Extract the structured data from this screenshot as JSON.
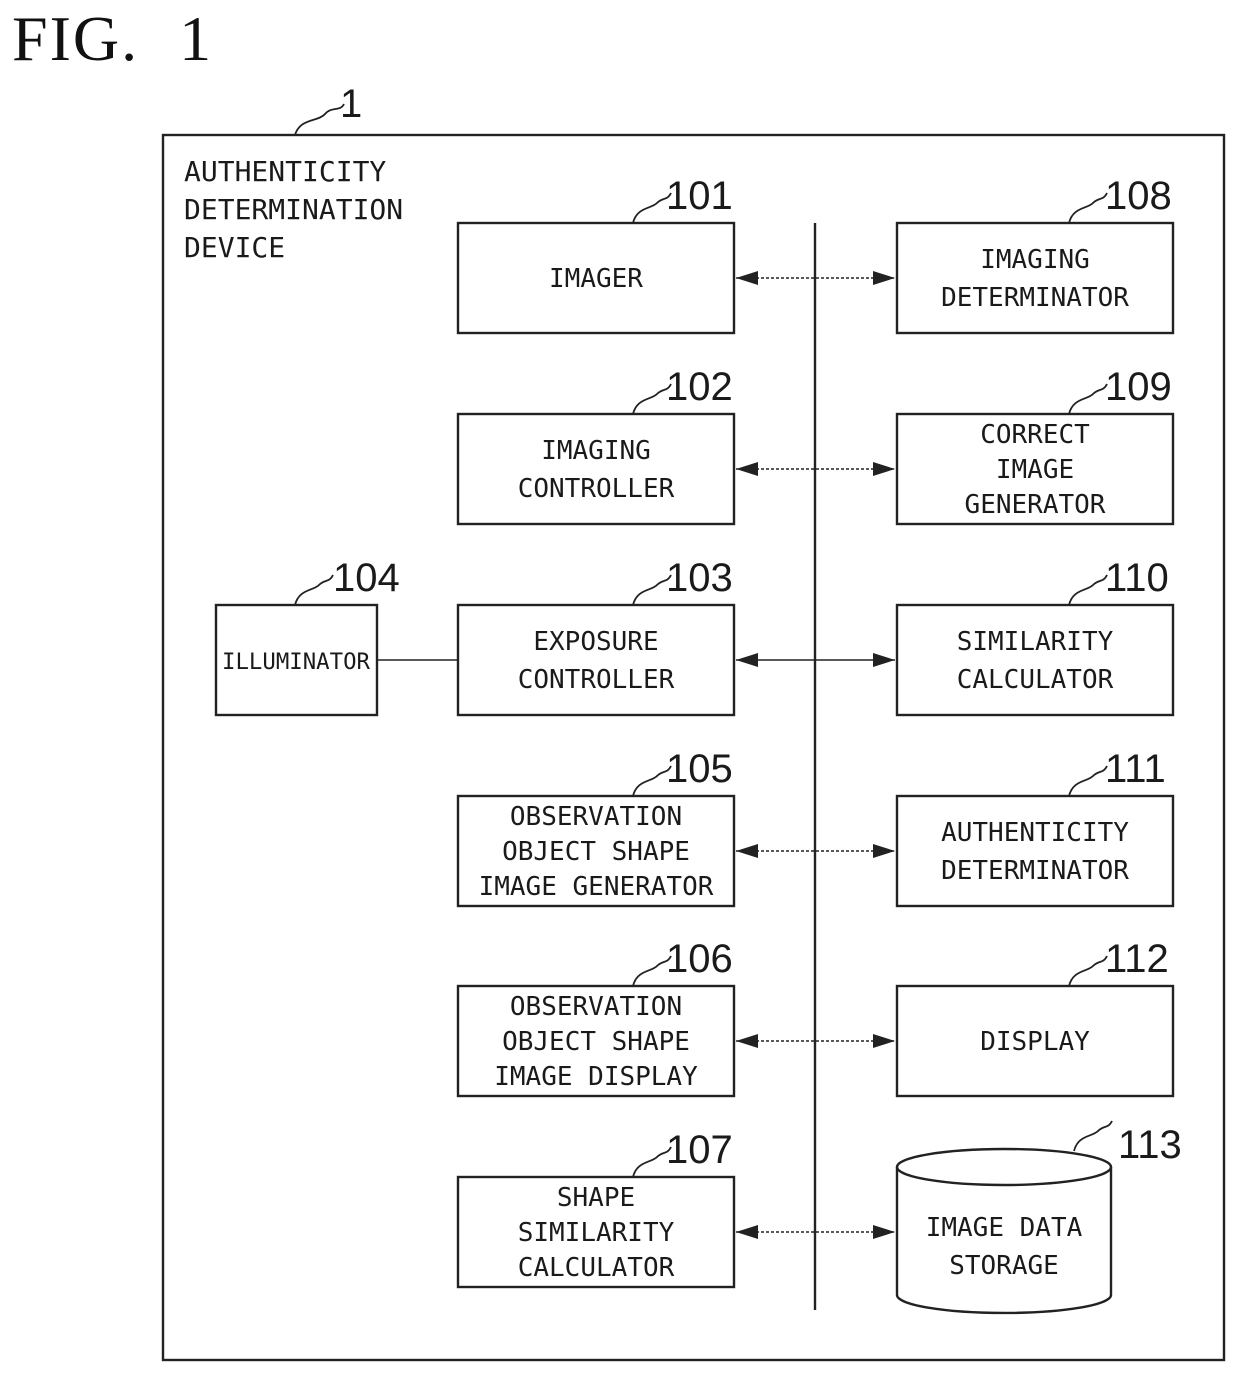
{
  "figure": {
    "prefix": "FIG.",
    "number": "1"
  },
  "device": {
    "ref": "1",
    "label_lines": [
      "AUTHENTICITY",
      "DETERMINATION",
      "DEVICE"
    ]
  },
  "left_blocks": [
    {
      "ref": "101",
      "lines": [
        "IMAGER"
      ]
    },
    {
      "ref": "102",
      "lines": [
        "IMAGING",
        "CONTROLLER"
      ]
    },
    {
      "ref": "103",
      "lines": [
        "EXPOSURE",
        "CONTROLLER"
      ]
    },
    {
      "ref": "105",
      "lines": [
        "OBSERVATION",
        "OBJECT SHAPE",
        "IMAGE GENERATOR"
      ]
    },
    {
      "ref": "106",
      "lines": [
        "OBSERVATION",
        "OBJECT SHAPE",
        "IMAGE DISPLAY"
      ]
    },
    {
      "ref": "107",
      "lines": [
        "SHAPE",
        "SIMILARITY",
        "CALCULATOR"
      ]
    }
  ],
  "right_blocks": [
    {
      "ref": "108",
      "lines": [
        "IMAGING",
        "DETERMINATOR"
      ]
    },
    {
      "ref": "109",
      "lines": [
        "CORRECT",
        "IMAGE",
        "GENERATOR"
      ]
    },
    {
      "ref": "110",
      "lines": [
        "SIMILARITY",
        "CALCULATOR"
      ]
    },
    {
      "ref": "111",
      "lines": [
        "AUTHENTICITY",
        "DETERMINATOR"
      ]
    },
    {
      "ref": "112",
      "lines": [
        "DISPLAY"
      ]
    },
    {
      "ref": "113",
      "lines": [
        "IMAGE DATA",
        "STORAGE"
      ],
      "shape": "cylinder"
    }
  ],
  "illuminator": {
    "ref": "104",
    "lines": [
      "ILLUMINATOR"
    ],
    "connected_to": "103"
  },
  "connections": [
    {
      "from": "101",
      "to": "108",
      "type": "bidirectional-bus"
    },
    {
      "from": "102",
      "to": "109",
      "type": "bidirectional-bus"
    },
    {
      "from": "103",
      "to": "110",
      "type": "bidirectional-bus"
    },
    {
      "from": "105",
      "to": "111",
      "type": "bidirectional-bus"
    },
    {
      "from": "106",
      "to": "112",
      "type": "bidirectional-bus"
    },
    {
      "from": "107",
      "to": "113",
      "type": "bidirectional-bus"
    },
    {
      "from": "104",
      "to": "103",
      "type": "line"
    }
  ]
}
